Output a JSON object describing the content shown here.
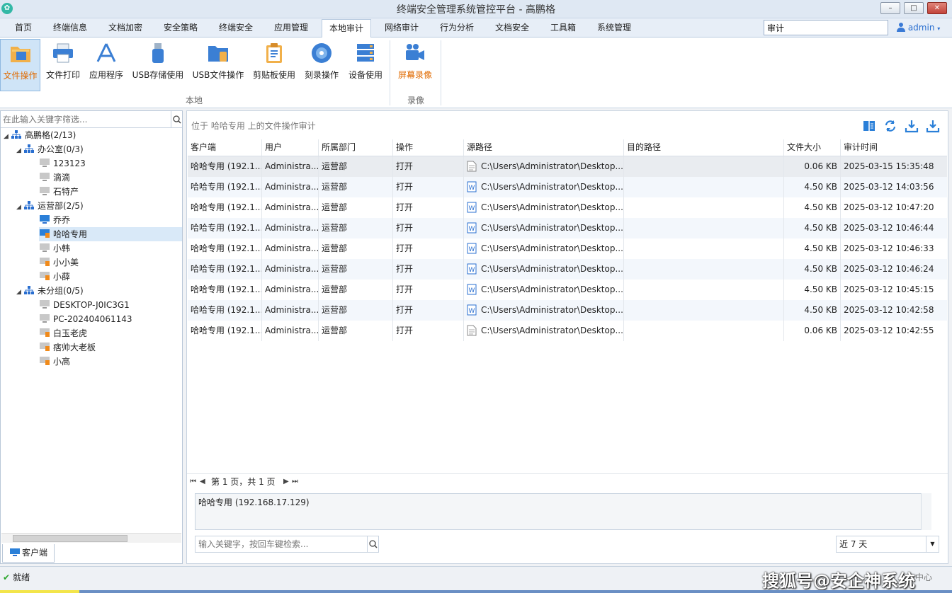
{
  "window": {
    "title": "终端安全管理系统管控平台 - 高鹏格",
    "min": "–",
    "max": "□",
    "close": "✕"
  },
  "tabs": [
    "首页",
    "终端信息",
    "文档加密",
    "安全策略",
    "终端安全",
    "应用管理",
    "本地审计",
    "网络审计",
    "行为分析",
    "文档安全",
    "工具箱",
    "系统管理"
  ],
  "active_tab": "本地审计",
  "top_search": {
    "value": "审计"
  },
  "user": {
    "name": "admin"
  },
  "ribbon": {
    "items": [
      "文件操作",
      "文件打印",
      "应用程序",
      "USB存储使用",
      "USB文件操作",
      "剪贴板使用",
      "刻录操作",
      "设备使用",
      "屏幕录像"
    ],
    "groups": [
      "本地",
      "录像"
    ]
  },
  "left": {
    "filter_placeholder": "在此输入关键字筛选...",
    "tree": [
      {
        "label": "高鹏格(2/13)"
      },
      {
        "label": "办公室(0/3)"
      },
      {
        "label": "123123"
      },
      {
        "label": "滴滴"
      },
      {
        "label": "石特产"
      },
      {
        "label": "运营部(2/5)"
      },
      {
        "label": "乔乔"
      },
      {
        "label": "哈哈专用"
      },
      {
        "label": "小韩"
      },
      {
        "label": "小小美"
      },
      {
        "label": "小薛"
      },
      {
        "label": "未分组(0/5)"
      },
      {
        "label": "DESKTOP-J0IC3G1"
      },
      {
        "label": "PC-202404061143"
      },
      {
        "label": "白玉老虎"
      },
      {
        "label": "痞帅大老板"
      },
      {
        "label": "小高"
      }
    ],
    "bottom_tab": "客户端"
  },
  "main": {
    "breadcrumb": "位于 哈哈专用 上的文件操作审计",
    "columns": [
      "客户端",
      "用户",
      "所属部门",
      "操作",
      "源路径",
      "目的路径",
      "文件大小",
      "审计时间"
    ],
    "rows": [
      {
        "client": "哈哈专用 (192.1...",
        "user": "Administra...",
        "dept": "运营部",
        "op": "打开",
        "src": "C:\\Users\\Administrator\\Desktop...",
        "dst": "",
        "size": "0.06 KB",
        "time": "2025-03-15 15:35:48"
      },
      {
        "client": "哈哈专用 (192.1...",
        "user": "Administra...",
        "dept": "运营部",
        "op": "打开",
        "src": "C:\\Users\\Administrator\\Desktop...",
        "dst": "",
        "size": "4.50 KB",
        "time": "2025-03-12 14:03:56"
      },
      {
        "client": "哈哈专用 (192.1...",
        "user": "Administra...",
        "dept": "运营部",
        "op": "打开",
        "src": "C:\\Users\\Administrator\\Desktop...",
        "dst": "",
        "size": "4.50 KB",
        "time": "2025-03-12 10:47:20"
      },
      {
        "client": "哈哈专用 (192.1...",
        "user": "Administra...",
        "dept": "运营部",
        "op": "打开",
        "src": "C:\\Users\\Administrator\\Desktop...",
        "dst": "",
        "size": "4.50 KB",
        "time": "2025-03-12 10:46:44"
      },
      {
        "client": "哈哈专用 (192.1...",
        "user": "Administra...",
        "dept": "运营部",
        "op": "打开",
        "src": "C:\\Users\\Administrator\\Desktop...",
        "dst": "",
        "size": "4.50 KB",
        "time": "2025-03-12 10:46:33"
      },
      {
        "client": "哈哈专用 (192.1...",
        "user": "Administra...",
        "dept": "运营部",
        "op": "打开",
        "src": "C:\\Users\\Administrator\\Desktop...",
        "dst": "",
        "size": "4.50 KB",
        "time": "2025-03-12 10:46:24"
      },
      {
        "client": "哈哈专用 (192.1...",
        "user": "Administra...",
        "dept": "运营部",
        "op": "打开",
        "src": "C:\\Users\\Administrator\\Desktop...",
        "dst": "",
        "size": "4.50 KB",
        "time": "2025-03-12 10:45:15"
      },
      {
        "client": "哈哈专用 (192.1...",
        "user": "Administra...",
        "dept": "运营部",
        "op": "打开",
        "src": "C:\\Users\\Administrator\\Desktop...",
        "dst": "",
        "size": "4.50 KB",
        "time": "2025-03-12 10:42:58"
      },
      {
        "client": "哈哈专用 (192.1...",
        "user": "Administra...",
        "dept": "运营部",
        "op": "打开",
        "src": "C:\\Users\\Administrator\\Desktop...",
        "dst": "",
        "size": "0.06 KB",
        "time": "2025-03-12 10:42:55"
      }
    ],
    "pager": {
      "text": "第 1 页，共 1 页",
      "first": "⏮",
      "prev": "◀",
      "next": "▶",
      "last": "⏭"
    },
    "detail": "哈哈专用 (192.168.17.129)",
    "keyword_placeholder": "输入关键字，按回车键检索...",
    "range": "近 7 天"
  },
  "status": {
    "text": "就绪",
    "right": "中心",
    "watermark": "搜狐号@安企神系统"
  }
}
